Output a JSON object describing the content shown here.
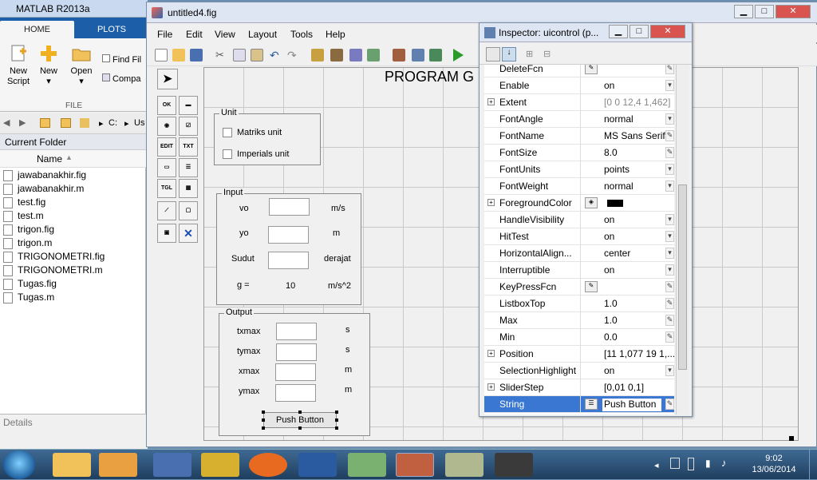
{
  "matlab": {
    "title": "MATLAB R2013a",
    "tabs": [
      "HOME",
      "PLOTS"
    ],
    "ribbon": {
      "new_script": [
        "New",
        "Script"
      ],
      "new": "New",
      "open": "Open",
      "find_files": "Find Fil",
      "compare": "Compa",
      "group": "FILE"
    },
    "address": [
      "C:",
      "Us"
    ],
    "current_folder": "Current Folder",
    "col_name": "Name",
    "files": [
      "jawabanakhir.fig",
      "jawabanakhir.m",
      "test.fig",
      "test.m",
      "trigon.fig",
      "trigon.m",
      "TRIGONOMETRI.fig",
      "TRIGONOMETRI.m",
      "Tugas.fig",
      "Tugas.m"
    ],
    "details": "Details"
  },
  "guide": {
    "title": "untitled4.fig",
    "menu": [
      "File",
      "Edit",
      "View",
      "Layout",
      "Tools",
      "Help"
    ],
    "palette": [
      "OK",
      "",
      "",
      "",
      "EDIT",
      "TXT",
      "",
      "",
      "TGL",
      "",
      "",
      "",
      "",
      ""
    ],
    "canvas_title": "PROGRAM G",
    "unit_panel": {
      "title": "Unit",
      "matriks": "Matriks unit",
      "imperials": "Imperials unit"
    },
    "input_panel": {
      "title": "Input",
      "rows": [
        {
          "label": "vo",
          "unit": "m/s"
        },
        {
          "label": "yo",
          "unit": "m"
        },
        {
          "label": "Sudut",
          "unit": "derajat"
        },
        {
          "label": "g =",
          "value": "10",
          "unit": "m/s^2"
        }
      ]
    },
    "output_panel": {
      "title": "Output",
      "rows": [
        {
          "label": "txmax",
          "unit": "s"
        },
        {
          "label": "tymax",
          "unit": "s"
        },
        {
          "label": "xmax",
          "unit": "m"
        },
        {
          "label": "ymax",
          "unit": "m"
        }
      ],
      "button": "Push Button"
    }
  },
  "inspector": {
    "title": "Inspector:  uicontrol (p...",
    "props": [
      {
        "name": "DeleteFcn",
        "value": "",
        "kind": "fn"
      },
      {
        "name": "Enable",
        "value": "on",
        "kind": "dd"
      },
      {
        "name": "Extent",
        "value": "[0 0 12,4 1,462]",
        "kind": "exp"
      },
      {
        "name": "FontAngle",
        "value": "normal",
        "kind": "dd"
      },
      {
        "name": "FontName",
        "value": "MS Sans Serif",
        "kind": "ed"
      },
      {
        "name": "FontSize",
        "value": "8.0",
        "kind": "ed"
      },
      {
        "name": "FontUnits",
        "value": "points",
        "kind": "dd"
      },
      {
        "name": "FontWeight",
        "value": "normal",
        "kind": "dd"
      },
      {
        "name": "ForegroundColor",
        "value": "",
        "kind": "color"
      },
      {
        "name": "HandleVisibility",
        "value": "on",
        "kind": "dd"
      },
      {
        "name": "HitTest",
        "value": "on",
        "kind": "dd"
      },
      {
        "name": "HorizontalAlign...",
        "value": "center",
        "kind": "dd"
      },
      {
        "name": "Interruptible",
        "value": "on",
        "kind": "dd"
      },
      {
        "name": "KeyPressFcn",
        "value": "",
        "kind": "fn"
      },
      {
        "name": "ListboxTop",
        "value": "1.0",
        "kind": "ed"
      },
      {
        "name": "Max",
        "value": "1.0",
        "kind": "ed"
      },
      {
        "name": "Min",
        "value": "0.0",
        "kind": "ed"
      },
      {
        "name": "Position",
        "value": "[11 1,077 19 1,...",
        "kind": "exp"
      },
      {
        "name": "SelectionHighlight",
        "value": "on",
        "kind": "dd"
      },
      {
        "name": "SliderStep",
        "value": "[0,01 0,1]",
        "kind": "exp"
      },
      {
        "name": "String",
        "value": "Push Button",
        "kind": "sel"
      }
    ]
  },
  "taskbar": {
    "time": "9:02",
    "date": "13/06/2014"
  },
  "colors": {
    "foreground_swatch": "#000000",
    "selection": "#3a77d2"
  }
}
